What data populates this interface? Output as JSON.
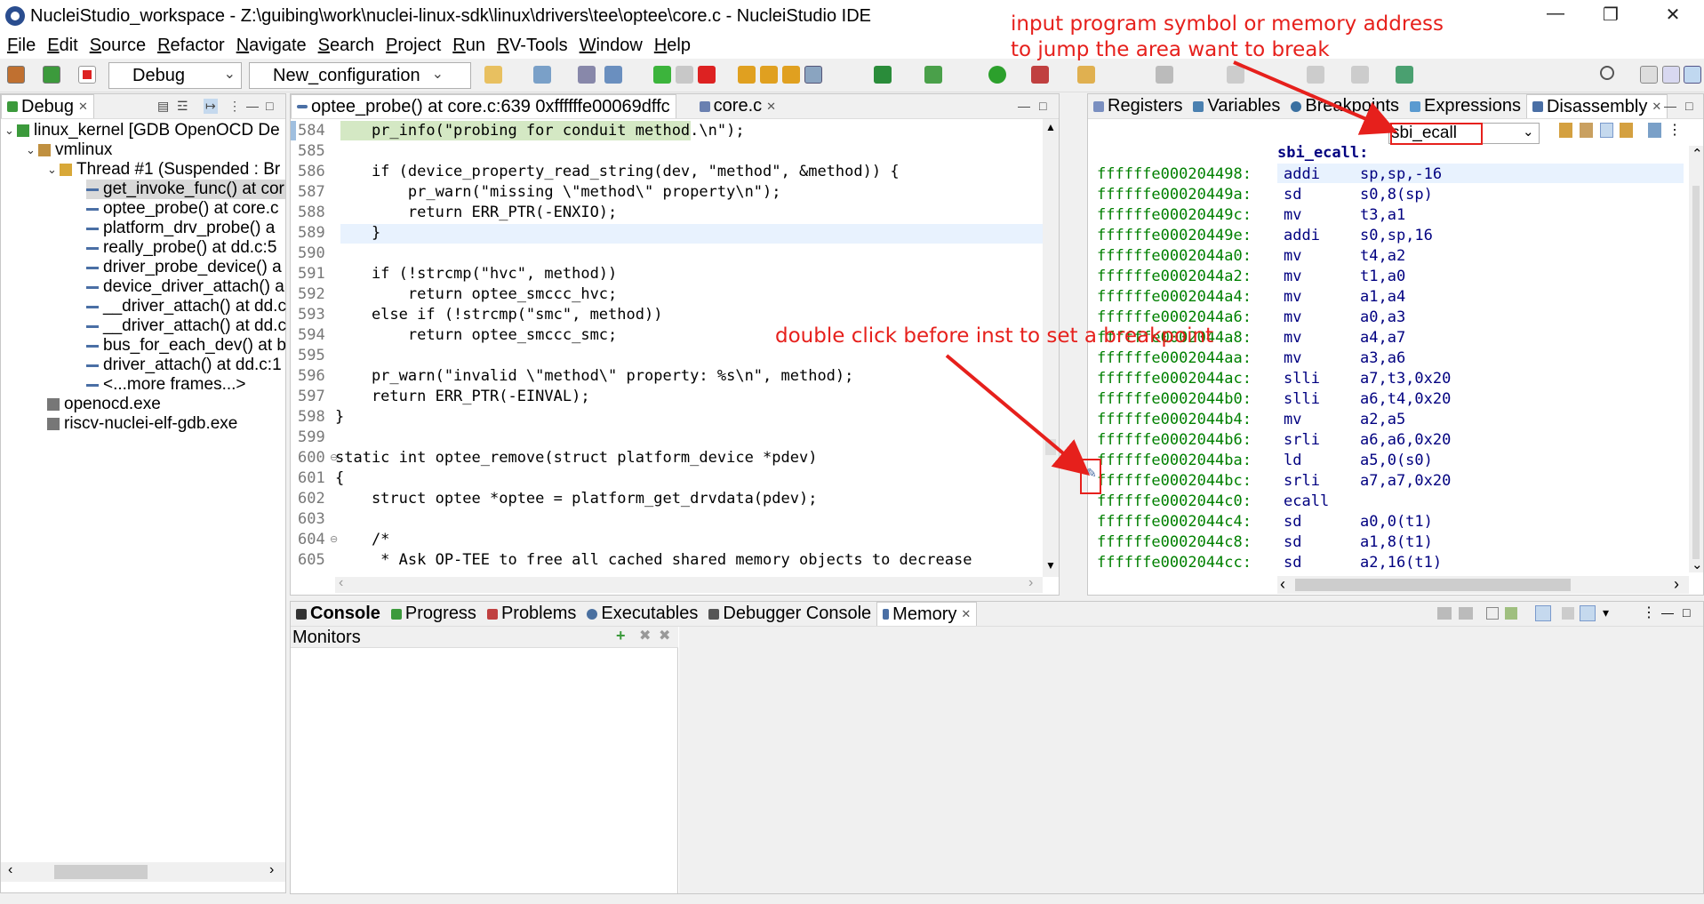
{
  "window": {
    "title": "NucleiStudio_workspace - Z:\\guibing\\work\\nuclei-linux-sdk\\linux\\drivers\\tee\\optee\\core.c - NucleiStudio IDE"
  },
  "menu": [
    "File",
    "Edit",
    "Source",
    "Refactor",
    "Navigate",
    "Search",
    "Project",
    "Run",
    "RV-Tools",
    "Window",
    "Help"
  ],
  "toolbar": {
    "launch_mode": "Debug",
    "launch_config": "New_configuration"
  },
  "debug_view": {
    "tab": "Debug",
    "items": [
      "linux_kernel [GDB OpenOCD De",
      "vmlinux",
      "Thread #1 (Suspended : Br",
      "get_invoke_func() at cor",
      "optee_probe() at core.c",
      "platform_drv_probe() a",
      "really_probe() at dd.c:5",
      "driver_probe_device() a",
      "device_driver_attach() a",
      "__driver_attach() at dd.c",
      "__driver_attach() at dd.c",
      "bus_for_each_dev() at b",
      "driver_attach() at dd.c:1",
      "<...more frames...>",
      "openocd.exe",
      "riscv-nuclei-elf-gdb.exe"
    ]
  },
  "editor": {
    "tabs": [
      "optee_probe() at core.c:639 0xffffffe00069dffc",
      "core.c"
    ],
    "line_numbers": [
      "584",
      "585",
      "586",
      "587",
      "588",
      "589",
      "590",
      "591",
      "592",
      "593",
      "594",
      "595",
      "596",
      "597",
      "598",
      "599",
      "600",
      "601",
      "602",
      "603",
      "604",
      "605"
    ],
    "lines": [
      "    pr_info(\"probing for conduit method.\\n\");",
      "",
      "    if (device_property_read_string(dev, \"method\", &method)) {",
      "        pr_warn(\"missing \\\"method\\\" property\\n\");",
      "        return ERR_PTR(-ENXIO);",
      "    }",
      "",
      "    if (!strcmp(\"hvc\", method))",
      "        return optee_smccc_hvc;",
      "    else if (!strcmp(\"smc\", method))",
      "        return optee_smccc_smc;",
      "",
      "    pr_warn(\"invalid \\\"method\\\" property: %s\\n\", method);",
      "    return ERR_PTR(-EINVAL);",
      "}",
      "",
      "static int optee_remove(struct platform_device *pdev)",
      "{",
      "    struct optee *optee = platform_get_drvdata(pdev);",
      "",
      "    /*",
      "     * Ask OP-TEE to free all cached shared memory objects to decrease"
    ]
  },
  "right_view": {
    "tabs": [
      "Registers",
      "Variables",
      "Breakpoints",
      "Expressions",
      "Disassembly"
    ],
    "goto_input": "sbi_ecall",
    "label": "sbi_ecall:",
    "rows": [
      {
        "addr": "ffffffe000204498:",
        "op": "addi",
        "arg": "sp,sp,-16"
      },
      {
        "addr": "ffffffe00020449a:",
        "op": "sd",
        "arg": "s0,8(sp)"
      },
      {
        "addr": "ffffffe00020449c:",
        "op": "mv",
        "arg": "t3,a1"
      },
      {
        "addr": "ffffffe00020449e:",
        "op": "addi",
        "arg": "s0,sp,16"
      },
      {
        "addr": "ffffffe0002044a0:",
        "op": "mv",
        "arg": "t4,a2"
      },
      {
        "addr": "ffffffe0002044a2:",
        "op": "mv",
        "arg": "t1,a0"
      },
      {
        "addr": "ffffffe0002044a4:",
        "op": "mv",
        "arg": "a1,a4"
      },
      {
        "addr": "ffffffe0002044a6:",
        "op": "mv",
        "arg": "a0,a3"
      },
      {
        "addr": "ffffffe0002044a8:",
        "op": "mv",
        "arg": "a4,a7"
      },
      {
        "addr": "ffffffe0002044aa:",
        "op": "mv",
        "arg": "a3,a6"
      },
      {
        "addr": "ffffffe0002044ac:",
        "op": "slli",
        "arg": "a7,t3,0x20"
      },
      {
        "addr": "ffffffe0002044b0:",
        "op": "slli",
        "arg": "a6,t4,0x20"
      },
      {
        "addr": "ffffffe0002044b4:",
        "op": "mv",
        "arg": "a2,a5"
      },
      {
        "addr": "ffffffe0002044b6:",
        "op": "srli",
        "arg": "a6,a6,0x20"
      },
      {
        "addr": "ffffffe0002044ba:",
        "op": "ld",
        "arg": "a5,0(s0)"
      },
      {
        "addr": "ffffffe0002044bc:",
        "op": "srli",
        "arg": "a7,a7,0x20"
      },
      {
        "addr": "ffffffe0002044c0:",
        "op": "ecall",
        "arg": ""
      },
      {
        "addr": "ffffffe0002044c4:",
        "op": "sd",
        "arg": "a0,0(t1)"
      },
      {
        "addr": "ffffffe0002044c8:",
        "op": "sd",
        "arg": "a1,8(t1)"
      },
      {
        "addr": "ffffffe0002044cc:",
        "op": "sd",
        "arg": "a2,16(t1)"
      }
    ]
  },
  "bottom_view": {
    "tabs": [
      "Console",
      "Progress",
      "Problems",
      "Executables",
      "Debugger Console",
      "Memory"
    ],
    "monitors_label": "Monitors"
  },
  "annotations": {
    "top_line1": "input program symbol or memory address",
    "top_line2": "to jump the area want  to break",
    "middle": "double click before inst to set a breakpoint"
  },
  "colors": {
    "annotation": "#e6201c",
    "current_line": "#d4e8c4",
    "selection": "#c5d9ee"
  }
}
